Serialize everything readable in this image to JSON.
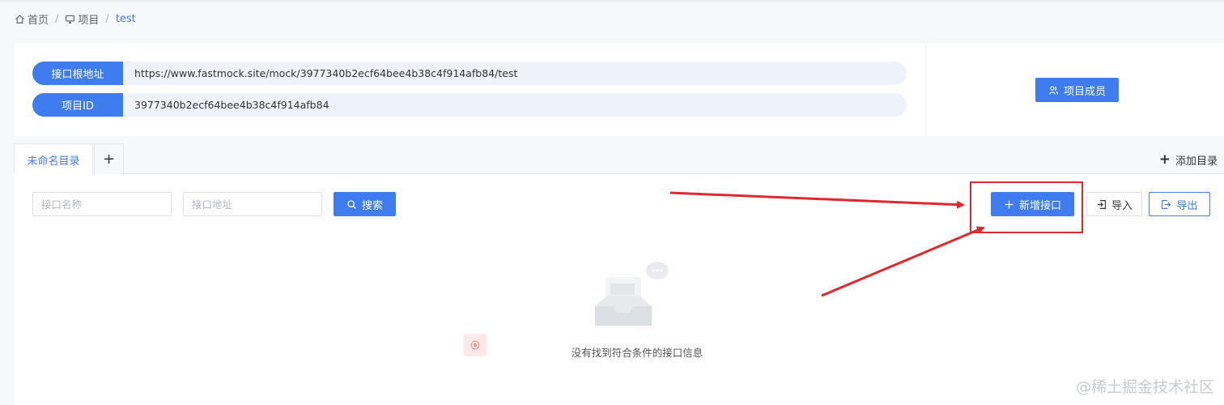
{
  "breadcrumb": {
    "home": "首页",
    "project": "项目",
    "current": "test",
    "separator": "/"
  },
  "info": {
    "root_label": "接口根地址",
    "root_value": "https://www.fastmock.site/mock/3977340b2ecf64bee4b38c4f914afb84/test",
    "id_label": "项目ID",
    "id_value": "3977340b2ecf64bee4b38c4f914afb84"
  },
  "members_button": "项目成员",
  "tabs": {
    "directory_tab": "未命名目录",
    "add_tab": "+",
    "add_directory": "添加目录"
  },
  "toolbar": {
    "name_placeholder": "接口名称",
    "path_placeholder": "接口地址",
    "search_label": "搜索",
    "new_api_label": "新增接口",
    "import_label": "导入",
    "export_label": "导出"
  },
  "empty_state": {
    "message": "没有找到符合条件的接口信息"
  },
  "watermark": "@稀土掘金技术社区",
  "colors": {
    "primary": "#3f7cf0",
    "annotation_red": "#e0282e",
    "background": "#f7f8fa"
  },
  "icons": {
    "home": "home-icon",
    "project": "monitor-icon",
    "members": "users-icon",
    "search": "search-icon",
    "plus": "plus-icon",
    "import": "import-icon",
    "export": "export-icon",
    "empty": "empty-inbox-icon"
  }
}
